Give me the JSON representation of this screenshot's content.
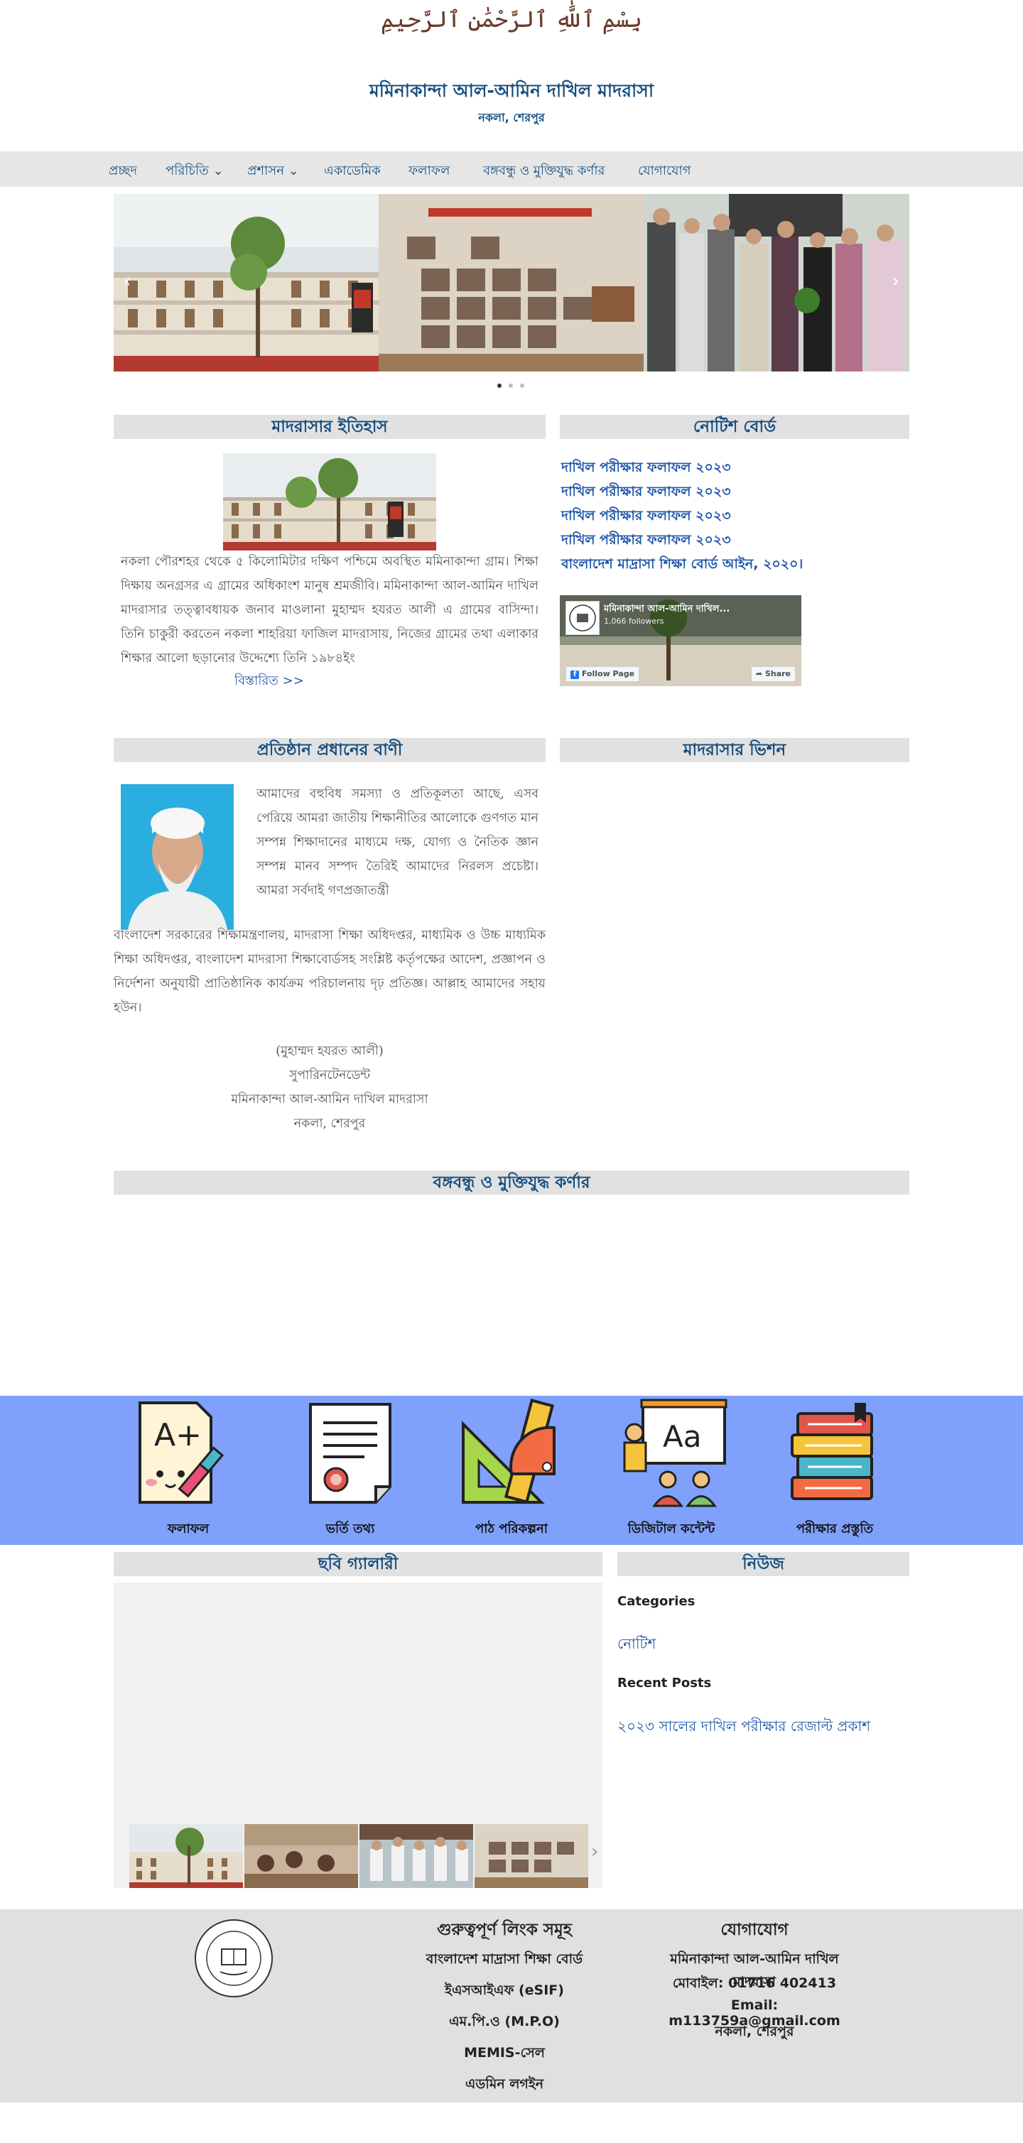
{
  "header": {
    "bismillah": "بِسْمِ ٱللَّٰهِ ٱلرَّحْمَٰنِ ٱلرَّحِيمِ",
    "title": "মমিনাকান্দা আল-আমিন দাখিল মাদরাসা",
    "subtitle": "নকলা, শেরপুর"
  },
  "nav": {
    "items": [
      {
        "label": "প্রচ্ছদ"
      },
      {
        "label": "পরিচিতি ⌄"
      },
      {
        "label": "প্রশাসন ⌄"
      },
      {
        "label": "একাডেমিক"
      },
      {
        "label": "ফলাফল"
      },
      {
        "label": "বঙ্গবন্ধু ও মুক্তিযুদ্ধ কর্ণার"
      },
      {
        "label": "যোগাযোগ"
      }
    ]
  },
  "slider": {
    "prev_icon": "chevron-left-icon",
    "next_icon": "chevron-right-icon",
    "slide_count": 3,
    "active_index": 0,
    "prev_glyph": "‹",
    "next_glyph": "›"
  },
  "history": {
    "heading": "মাদরাসার ইতিহাস",
    "text": "নকলা পৌরশহর থেকে ৫ কিলোমিটার দক্ষিণ পশ্চিমে অবস্থিত মমিনাকান্দা গ্রাম। শিক্ষা দিক্ষায় অনগ্রসর এ গ্রামের অধিকাংশ মানুষ শ্রমজীবি। মমিনাকান্দা আল-আমিন দাখিল মাদরাসার তত্ত্বাবধায়ক জনাব মাওলানা মুহাম্মদ হযরত আলী এ গ্রামের বাসিন্দা। তিনি চাকুরী করতেন নকলা শাহরিয়া ফাজিল মাদরাসায়, নিজের গ্রামের তথা এলাকার শিক্ষার আলো ছড়ানোর উদ্দেশ্যে তিনি ১৯৮৪ইং",
    "more_link": "বিস্তারিত >>"
  },
  "notice_board": {
    "heading": "নোটিশ বোর্ড",
    "items": [
      "দাখিল পরীক্ষার ফলাফল ২০২৩",
      "দাখিল পরীক্ষার ফলাফল ২০২৩",
      "দাখিল পরীক্ষার ফলাফল ২০২৩",
      "দাখিল পরীক্ষার ফলাফল ২০২৩",
      "বাংলাদেশ মাদ্রাসা শিক্ষা বোর্ড আইন, ২০২০।"
    ],
    "facebook": {
      "page_name": "মমিনাকান্দা আল-আমিন দাখিল...",
      "followers": "1,066 followers",
      "follow_label": "Follow Page",
      "share_label": "Share"
    }
  },
  "principal": {
    "heading": "প্রতিষ্ঠান প্রধানের বাণী",
    "text_side": "আমাদের বহুবিধ সমস্যা ও প্রতিকূলতা আছে, এসব পেরিয়ে আমরা জাতীয় শিক্ষানীতির আলোকে গুণগত মান সম্পন্ন শিক্ষাদানের মাধ্যমে দক্ষ, যোগ্য ও নৈতিক জ্ঞান সম্পন্ন মানব সম্পদ তৈরিই আমাদের নিরলস প্রচেষ্টা। আমরা সর্বদাই গণপ্রজাতন্ত্রী",
    "text_full": "বাংলাদেশ সরকারের শিক্ষামন্ত্রণালয়, মাদরাসা শিক্ষা অধিদপ্তর, মাধ্যমিক ও উচ্চ মাধ্যমিক শিক্ষা অধিদপ্তর, বাংলাদেশ মাদরাসা শিক্ষাবোর্ডসহ সংশ্লিষ্ট কর্তৃপক্ষের আদেশ, প্রজ্ঞাপন ও নির্দেশনা অনুযায়ী প্রাতিষ্ঠানিক কার্যক্রম পরিচালনায় দৃঢ় প্রতিজ্ঞ। আল্লাহ আমাদের সহায় হউন।",
    "sign_name": "(মুহাম্মদ হযরত আলী)",
    "sign_title": "সুপারিনটেনডেন্ট",
    "sign_org": "মমিনাকান্দা আল-আমিন দাখিল মাদরাসা",
    "sign_place": "নকলা, শেরপুর"
  },
  "vision": {
    "heading": "মাদরাসার ভিশন"
  },
  "corner": {
    "heading": "বঙ্গবন্ধু ও মুক্তিযুদ্ধ কর্ণার"
  },
  "features": [
    {
      "label": "ফলাফল",
      "icon": "grade-paper-icon"
    },
    {
      "label": "ভর্তি তথ্য",
      "icon": "certificate-icon"
    },
    {
      "label": "পাঠ পরিকল্পনা",
      "icon": "geometry-tools-icon"
    },
    {
      "label": "ডিজিটাল কন্টেন্ট",
      "icon": "teacher-board-icon"
    },
    {
      "label": "পরীক্ষার প্রস্তুতি",
      "icon": "books-icon"
    }
  ],
  "gallery": {
    "heading": "ছবি গ্যালারী",
    "next_glyph": "›"
  },
  "news": {
    "heading": "নিউজ",
    "categories_label": "Categories",
    "category_item": "নোটিশ",
    "recent_label": "Recent Posts",
    "recent_item": "২০২৩ সালের দাখিল পরীক্ষার রেজাল্ট প্রকাশ"
  },
  "footer": {
    "links_heading": "গুরুত্বপূর্ণ লিংক সমূহ",
    "links": [
      "বাংলাদেশ মাদ্রাসা শিক্ষা বোর্ড",
      "ইএসআইএফ (eSIF)",
      "এম.পি.ও (M.P.O)",
      "MEMIS-সেল",
      "এডমিন লগইন"
    ],
    "contact_heading": "যোগাযোগ",
    "contact_org": "মমিনাকান্দা আল-আমিন দাখিল মাদরাসা",
    "contact_phone": "মোবাইল: 01716 402413",
    "contact_email": "Email: m113759a@gmail.com",
    "contact_place": "নকলা, শেরপুর"
  },
  "colors": {
    "brand": "#154d7e",
    "link": "#1f56a8",
    "band": "#80a1fb",
    "section_bg": "#e1e1e1"
  }
}
